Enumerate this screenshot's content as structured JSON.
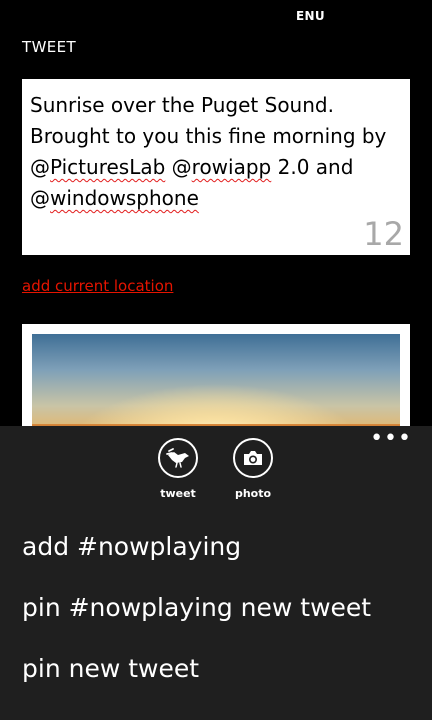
{
  "status_bar": {
    "language": "ENU"
  },
  "page": {
    "title": "TWEET"
  },
  "compose": {
    "segments": [
      {
        "text": "Sunrise over the Puget Sound. Brought to you this fine morning by @"
      },
      {
        "text": "PicturesLab",
        "spell": true
      },
      {
        "text": " @"
      },
      {
        "text": "rowiapp",
        "spell": true
      },
      {
        "text": " 2.0 and @"
      },
      {
        "text": "windowsphone",
        "spell": true
      }
    ],
    "char_count": "12"
  },
  "location": {
    "link_label": "add current location"
  },
  "app_bar": {
    "more_label": "•••",
    "buttons": [
      {
        "label": "tweet",
        "icon": "tweet-bird-icon"
      },
      {
        "label": "photo",
        "icon": "camera-icon"
      }
    ],
    "menu_items": [
      {
        "label": "add #nowplaying"
      },
      {
        "label": "pin #nowplaying new tweet"
      },
      {
        "label": "pin new tweet"
      }
    ]
  },
  "colors": {
    "background": "#000000",
    "app_bar": "#1f1f1f",
    "accent_link": "#e51400",
    "spellcheck": "#e21d1d",
    "counter": "#a8a8a8"
  }
}
